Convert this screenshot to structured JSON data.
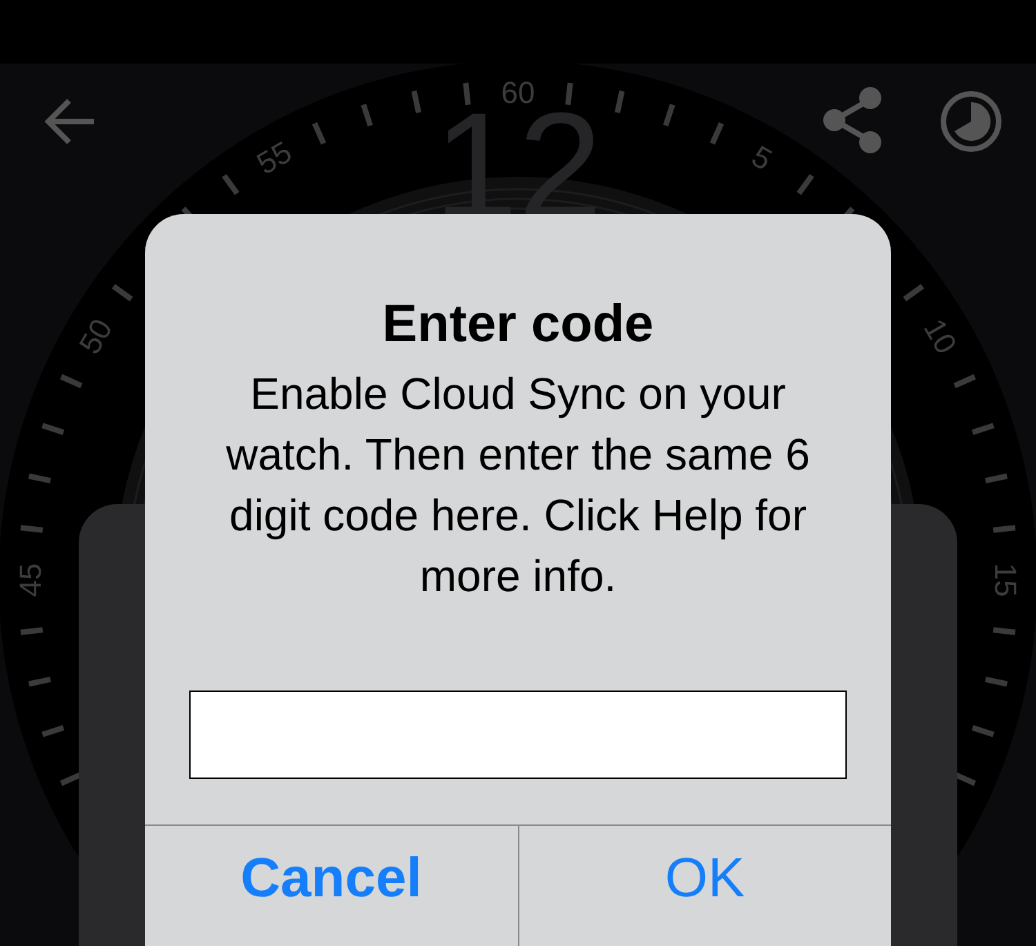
{
  "watch_face": {
    "dial_numbers": [
      "60",
      "5",
      "10",
      "15",
      "45",
      "50",
      "55"
    ],
    "hour_numeral": "12"
  },
  "dialog": {
    "title": "Enter code",
    "message": "Enable Cloud Sync on your watch. Then enter the same 6 digit code here. Click Help for more info.",
    "buttons": [
      {
        "label": "Cancel",
        "preferred": true
      },
      {
        "label": "OK",
        "preferred": false
      }
    ]
  }
}
